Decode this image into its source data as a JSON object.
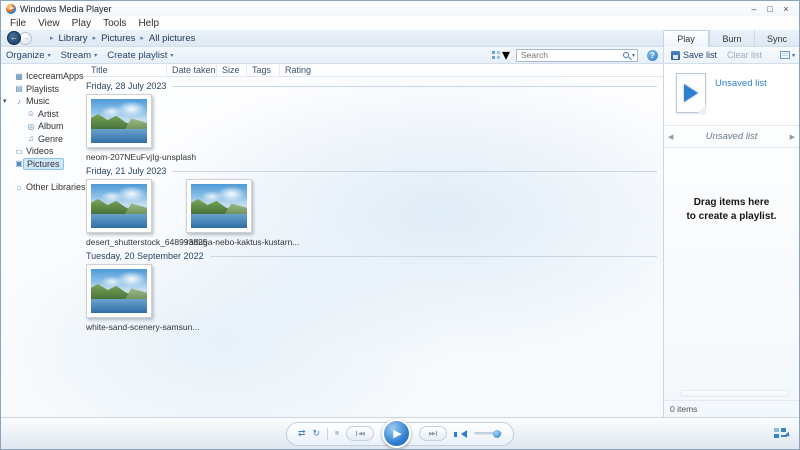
{
  "window": {
    "title": "Windows Media Player",
    "minimize": "–",
    "maximize": "□",
    "close": "×"
  },
  "menu": {
    "items": [
      "File",
      "View",
      "Play",
      "Tools",
      "Help"
    ]
  },
  "nav": {
    "breadcrumb": [
      "Library",
      "Pictures",
      "All pictures"
    ]
  },
  "tabs": [
    {
      "label": "Play"
    },
    {
      "label": "Burn"
    },
    {
      "label": "Sync"
    }
  ],
  "toolbar": {
    "organize": "Organize",
    "stream": "Stream",
    "create_playlist": "Create playlist"
  },
  "search": {
    "placeholder": "Search"
  },
  "panel": {
    "save_list": "Save list",
    "clear_list": "Clear list",
    "unsaved_list_title": "Unsaved list",
    "list_label": "Unsaved list",
    "drag_line1": "Drag items here",
    "drag_line2": "to create a playlist.",
    "status": "0 items"
  },
  "sidebar": {
    "items": [
      {
        "label": "IcecreamApps"
      },
      {
        "label": "Playlists"
      },
      {
        "label": "Music"
      },
      {
        "label": "Artist"
      },
      {
        "label": "Album"
      },
      {
        "label": "Genre"
      },
      {
        "label": "Videos"
      },
      {
        "label": "Pictures"
      },
      {
        "label": "Other Libraries"
      }
    ]
  },
  "list": {
    "columns": [
      "Title",
      "Date taken",
      "Size",
      "Tags",
      "Rating"
    ],
    "groups": [
      {
        "date": "Friday, 28 July 2023",
        "items": [
          {
            "name": "neom-207NEuFvjIg-unsplash"
          }
        ]
      },
      {
        "date": "Friday, 21 July 2023",
        "items": [
          {
            "name": "desert_shutterstock_648993825"
          },
          {
            "name": "raduga-nebo-kaktus-kustarn..."
          }
        ]
      },
      {
        "date": "Tuesday, 20 September 2022",
        "items": [
          {
            "name": "white-sand-scenery-samsun..."
          }
        ]
      }
    ]
  },
  "playback": {
    "help": "?"
  },
  "icons": {
    "dropdown": "▾",
    "tree_expanded": "▾",
    "crumb_arrow": "▸",
    "back_arrow": "←",
    "fwd_arrow": "→",
    "user_library": "▦",
    "playlists": "▤",
    "music": "♪",
    "artist": "☺",
    "album": "◎",
    "genre": "♫",
    "videos": "▭",
    "pictures": "▣",
    "other_libraries": "⌂",
    "shuffle": "⇄",
    "repeat": "↻",
    "stop": "■",
    "prev": "◀◀",
    "next": "▶▶",
    "play": "▶",
    "left_arrow": "◀",
    "right_arrow": "▶"
  },
  "colors": {
    "accent_blue": "#2f7fd0",
    "selection": "#cfe8f8",
    "chrome": "#e7eff8"
  }
}
